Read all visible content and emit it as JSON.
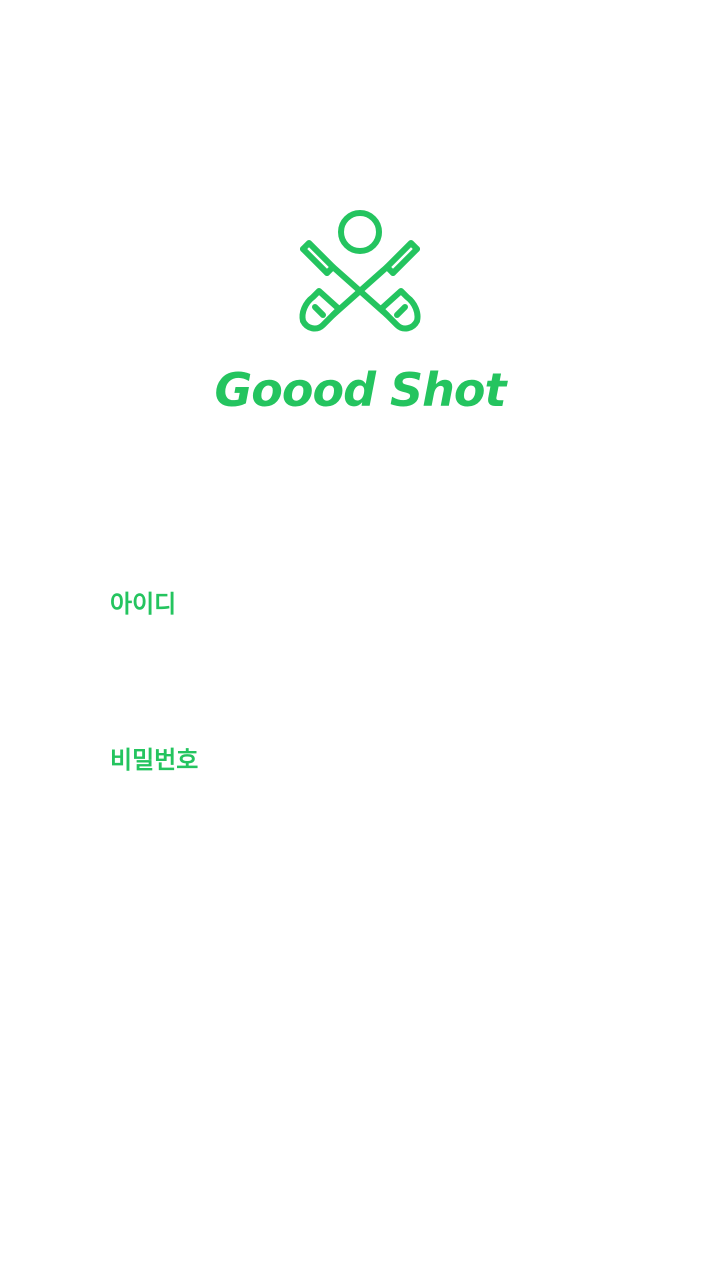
{
  "app": {
    "brand_name": "Goood Shot",
    "accent_color": "#24c45f",
    "logo_icon": "crossed-golf-clubs-with-ball-icon"
  },
  "login": {
    "id_label": "아이디",
    "id_value": "",
    "password_label": "비밀번호",
    "password_value": ""
  }
}
